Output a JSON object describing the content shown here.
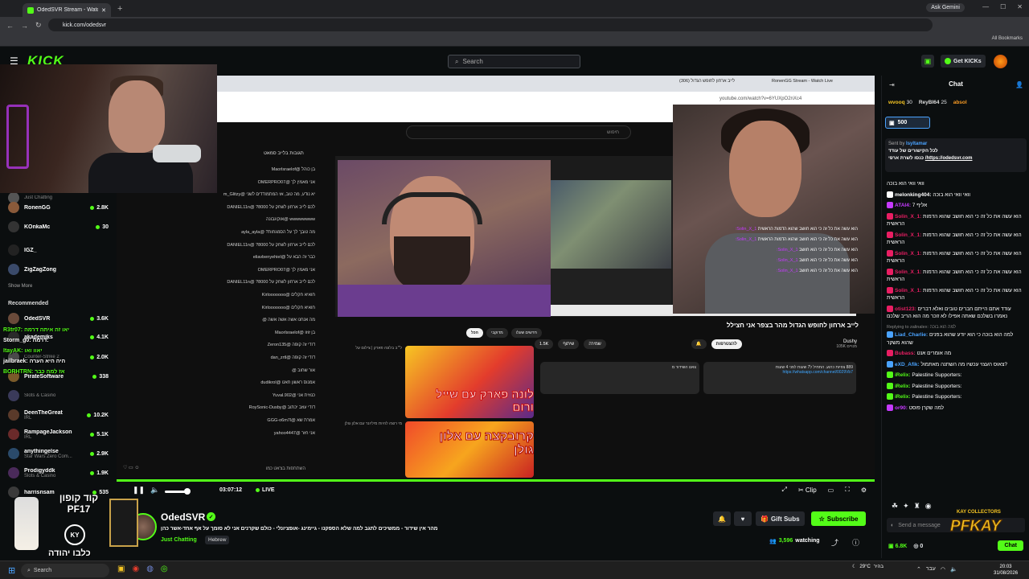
{
  "browser": {
    "tab_title": "OdedSVR Stream - Watch L",
    "url": "kick.com/odedsvr",
    "ask_gemini": "Ask Gemini",
    "all_bookmarks": "All Bookmarks"
  },
  "header": {
    "search_placeholder": "Search",
    "get_kicks": "Get KICKs"
  },
  "sidebar": {
    "following_items": [
      {
        "name": "",
        "category": "Just Chatting",
        "viewers": ""
      },
      {
        "name": "RonenGG",
        "category": "",
        "viewers": "2.8K"
      },
      {
        "name": "KOnkaMc",
        "category": "",
        "viewers": "30"
      },
      {
        "name": "IGZ_",
        "category": "",
        "viewers": ""
      },
      {
        "name": "ZigZagZong",
        "category": "",
        "viewers": ""
      }
    ],
    "show_more": "Show More",
    "recommended_label": "Recommended",
    "recommended": [
      {
        "name": "OdedSVR",
        "category": "",
        "viewers": "3.6K"
      },
      {
        "name": "akademiks",
        "category": "",
        "viewers": "4.1K"
      },
      {
        "name": "",
        "category": "Counter-Strike 2",
        "viewers": "2.0K"
      },
      {
        "name": "PirateSoftware",
        "category": "",
        "viewers": "338"
      },
      {
        "name": "",
        "category": "Slots & Casino",
        "viewers": ""
      },
      {
        "name": "DeenTheGreat",
        "category": "IRL",
        "viewers": "10.2K"
      },
      {
        "name": "RampageJackson",
        "category": "IRL",
        "viewers": "5.1K"
      },
      {
        "name": "anythingelse",
        "category": "Star Wars Zero Com...",
        "viewers": "2.9K"
      },
      {
        "name": "Prodigyddk",
        "category": "Slots & Casino",
        "viewers": "1.9K"
      },
      {
        "name": "harrisnsam",
        "category": "",
        "viewers": "535"
      }
    ],
    "overlay_msgs": [
      "R3tr07: יאו זה איתה דרמה",
      "Storm_g0: דרמה:",
      "ItayAK: יאוו ואו",
      "jailbraek: היה היא הערה",
      "BORHTRN: אז למה כבר"
    ]
  },
  "video": {
    "yt_url": "youtube.com/watch?v=6YUXpO2nXc4",
    "yt_search_placeholder": "חיפוש",
    "yt_tab1": "לייב ארחון לחופש הגדול (306)",
    "yt_tab2": "RonenGG Stream - Watch Live",
    "livechat_title": "תגובות בלייב סמאט",
    "livechat_lines": [
      "בן כוהל @Maorlsraelof",
      "אני מאמין לך @OMERPRO07",
      "יא נודע, מה טוב, אז המתמודדים לשני @m_Glitzy",
      "לכם לייב ארחון לשחק על 8000? @DANIEL11n",
      "wwwwwwww @אוקיגבונה",
      "מה טובך לך על הסמגחות? @ayla_ayla",
      "לכם לייב ארחון לשחק על 8000? @DANIEL11n",
      "כבר זה הבא על @eliavbenyehiel",
      "אני מאמין לך @OMERPRO07",
      "לכם לייב ארחון לשחק על 8000? @DANIEL11n",
      "חואיא חקלים @Kirlooooooo",
      "חואיא חקלים @Kirlooooooo",
      "מה אנחנו אשה אשה אשה @",
      "בן זוזו @Maorlsraelof",
      "דודי זה קופה @Zeron135",
      "דודי זה קופה @dan_zrtl",
      "אור שחוב @",
      "אמנוס ראשון חאט @dudikrol",
      "כנוזית אני @Yuval.902",
      "דודי עוזב יכתוב @RoySonic-Dusby",
      "אמרת שא @GGG-o6m7l",
      "אני חזר @yahoo4447"
    ],
    "livechat_input": "השתתפות בצ'אט כמו",
    "yt_title": "לייב ארחון לחופש הגדול מהר בצפר אני חצילל",
    "yt_channel": "Dushy",
    "yt_subs": "105K מנויים",
    "yt_subscribe": "להצטרפות",
    "yt_likes": "1.5K",
    "yt_share": "שיתוף",
    "yt_save": "שמירה",
    "yt_chips": [
      "הכל",
      "מדוקבי",
      "חדשים שעלו"
    ],
    "yt_desc_text": "889 צפיות כרגע. התחיל ל7 שעות לפני 4 שעות",
    "yt_desc_link": "https://whatsapp.com/channel/0029Vb7",
    "yt_comment_text": "צאט השידור מ",
    "thumb_a_text": "לונה פארק עם שייל ורום",
    "thumb_b_text": "קרובקצה עם אלון גולן",
    "rec_a_meta": "ל״ב בלונה פארק | צילום על",
    "rec_b_meta": "מי רוצה להיות מיליונר עם אלון גולן",
    "oded_chat": [
      {
        "user": "Solin_X_1:",
        "text": "הוא עשה את כל זה כי הוא חושב שהוא הדמות הראשית"
      },
      {
        "user": "Solin_X_1:",
        "text": "הוא עשה את כל זה כי הוא חושב שהוא הדמות הראשית"
      },
      {
        "user": "Solin_X_1:",
        "text": "הוא עשה את כל זה כי הוא חושב"
      },
      {
        "user": "Solin_X_1:",
        "text": "הוא עשה את כל זה כי הוא חושב"
      },
      {
        "user": "Solin_X_1:",
        "text": "הוא עשה את כל זה כי הוא חושב"
      }
    ]
  },
  "player": {
    "time": "03:07:12",
    "live_label": "LIVE",
    "clip_label": "Clip"
  },
  "stream": {
    "streamer": "OdedSVR",
    "title": "מהר אין שידור - ממשיכים לתגב למה שלא הספקנו - גיימינג -אופציונלי - כולם שקרנים אני לא סומך על אף אחד-אשר כהן",
    "category": "Just Chatting",
    "language": "Hebrew",
    "gift_subs": "Gift Subs",
    "subscribe": "Subscribe",
    "watching_count": "3,596",
    "watching_label": "watching"
  },
  "chat": {
    "title": "Chat",
    "gifters": [
      {
        "name": "wvooq",
        "count": "30"
      },
      {
        "name": "ReyBI64",
        "count": "25"
      },
      {
        "name": "absol",
        "count": ""
      }
    ],
    "kicks_badge": "500",
    "pinned_sent_by": "Sent by",
    "pinned_sender": "Isyltamar",
    "pinned_msg": "לכל הקישורים של עודד",
    "pinned_link": "https://odedsvr.com/",
    "pinned_suffix": "כנסו לשרת ארפי",
    "messages": [
      {
        "user": "",
        "color": "#ffffff",
        "text": "וואי וואי הוא בוכה",
        "reply": ""
      },
      {
        "user": "melonking404:",
        "color": "#ffffff",
        "text": "וואי וואי הוא בוכה",
        "reply": ""
      },
      {
        "user": "ATAI4:",
        "color": "#c63aff",
        "text": "אליף 7",
        "reply": ""
      },
      {
        "user": "Solin_X_1:",
        "color": "#e91e63",
        "text": "הוא עשה את כל זה כי הוא חושב שהוא הדמות הראשית",
        "reply": ""
      },
      {
        "user": "Solin_X_1:",
        "color": "#e91e63",
        "text": "הוא עשה את כל זה כי הוא חושב שהוא הדמות הראשית",
        "reply": ""
      },
      {
        "user": "Solin_X_1:",
        "color": "#e91e63",
        "text": "הוא עשה את כל זה כי הוא חושב שהוא הדמות הראשית",
        "reply": ""
      },
      {
        "user": "Solin_X_1:",
        "color": "#e91e63",
        "text": "הוא עשה את כל זה כי הוא חושב שהוא הדמות הראשית",
        "reply": ""
      },
      {
        "user": "Solin_X_1:",
        "color": "#e91e63",
        "text": "הוא עשה את כל זה כי הוא חושב שהוא הדמות הראשית",
        "reply": ""
      },
      {
        "user": "otist123:",
        "color": "#e91e63",
        "text": "עודד אתם הייתם חברים טובים ואלא דברים נאמרו בשלכם שאתה אפילו לא זוכר מה הוא הריב שלכם",
        "reply": ""
      },
      {
        "user": "Liad_Charlie:",
        "color": "#4aa3ff",
        "text": "למה הוא בוכה כי הוא יודע שהוא בפנים שהוא משקר",
        "reply": "Replying to zalinalex: למה הוא בוכה"
      },
      {
        "user": "Bubass:",
        "color": "#e91e63",
        "text": "מה אומרים אנט",
        "reply": ""
      },
      {
        "user": "eXD_Afik:",
        "color": "#4aa3ff",
        "text": "צאוס העצוי עכשיו מה השתנה מאתמול?",
        "reply": ""
      },
      {
        "user": "iRelix:",
        "color": "#53fc18",
        "text": "Palestine Supporters:",
        "reply": ""
      },
      {
        "user": "iRelix:",
        "color": "#53fc18",
        "text": "Palestine Supporters:",
        "reply": ""
      },
      {
        "user": "iRelix:",
        "color": "#53fc18",
        "text": "Palestine Supporters:",
        "reply": ""
      },
      {
        "user": "or90:",
        "color": "#c63aff",
        "text": "למה שקרן פוסט",
        "reply": ""
      }
    ],
    "input_placeholder": "Send a message",
    "kicks_balance": "6.8K",
    "points": "0",
    "send": "Chat"
  },
  "overlays": {
    "left_text": "קוד קופון PF17",
    "left_sub": "כלבו יהודה",
    "left_badge": "KY",
    "right_small": "KAY COLLECTORS",
    "right_text": "PFKAY"
  },
  "taskbar": {
    "search": "Search",
    "weather": "29°C",
    "weather_sub": "בהיר",
    "lang": "עבר",
    "time": "20:03",
    "date": "31/08/2026"
  }
}
